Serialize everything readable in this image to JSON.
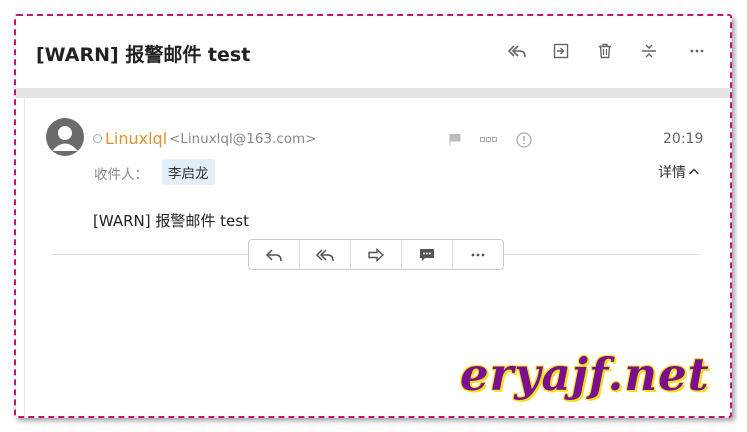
{
  "subject": "[WARN] 报警邮件 test",
  "toolbar_icons": [
    "reply-all-icon",
    "move-icon",
    "trash-icon",
    "collapse-icon",
    "more-icon"
  ],
  "sender": {
    "name": "Linuxlql",
    "email": "<Linuxlql@163.com>",
    "time": "20:19"
  },
  "recipient": {
    "label": "收件人：",
    "name": "李启龙"
  },
  "details_label": "详情",
  "body_text": "[WARN] 报警邮件 test",
  "action_icons": [
    "reply-icon",
    "reply-all-icon",
    "forward-icon",
    "comment-icon",
    "more-icon"
  ],
  "watermark": "eryajf.net",
  "colors": {
    "sender_name": "#e0922b",
    "frame_border": "#c0147a",
    "chip_bg": "#e3eefb",
    "watermark": "#7b0f8e",
    "watermark_outline": "#f0e020"
  }
}
